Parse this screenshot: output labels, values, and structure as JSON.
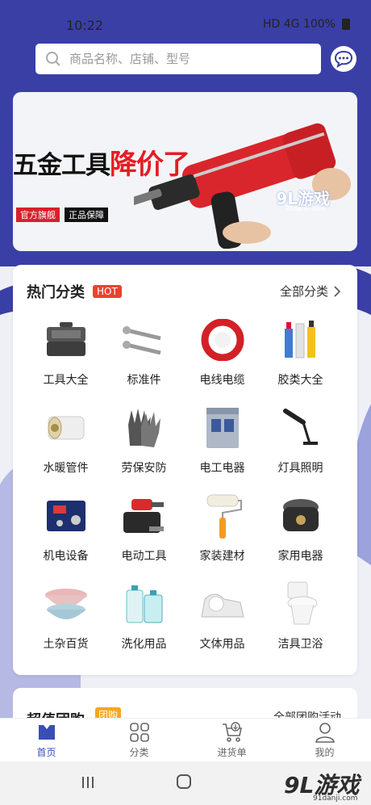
{
  "status_bar": {
    "time": "10:22",
    "indicators": "HD 4G 100%"
  },
  "search": {
    "placeholder": "商品名称、店铺、型号"
  },
  "banner": {
    "headline_prefix": "五金工具",
    "headline_highlight": "降价了",
    "tag1": "官方旗舰",
    "tag2": "正品保障",
    "watermark": "9L游戏",
    "watermark_url": "91danji.com"
  },
  "categories": {
    "title": "热门分类",
    "badge": "HOT",
    "all_label": "全部分类",
    "items": [
      {
        "label": "工具大全",
        "icon": "toolbox-icon"
      },
      {
        "label": "标准件",
        "icon": "screw-icon"
      },
      {
        "label": "电线电缆",
        "icon": "cable-icon"
      },
      {
        "label": "胶类大全",
        "icon": "glue-icon"
      },
      {
        "label": "水暖管件",
        "icon": "pipe-fitting-icon"
      },
      {
        "label": "劳保安防",
        "icon": "glove-icon"
      },
      {
        "label": "电工电器",
        "icon": "breaker-icon"
      },
      {
        "label": "灯具照明",
        "icon": "lamp-icon"
      },
      {
        "label": "机电设备",
        "icon": "welder-icon"
      },
      {
        "label": "电动工具",
        "icon": "screwdriver-icon"
      },
      {
        "label": "家装建材",
        "icon": "roller-icon"
      },
      {
        "label": "家用电器",
        "icon": "rice-cooker-icon"
      },
      {
        "label": "土杂百货",
        "icon": "basin-icon"
      },
      {
        "label": "洗化用品",
        "icon": "detergent-icon"
      },
      {
        "label": "文体用品",
        "icon": "tape-dispenser-icon"
      },
      {
        "label": "洁具卫浴",
        "icon": "toilet-icon"
      }
    ]
  },
  "group_buy": {
    "title": "超值团购",
    "badge": "团购",
    "more": "全部团购活动"
  },
  "bottom_nav": [
    {
      "label": "首页",
      "icon": "home-icon",
      "active": true
    },
    {
      "label": "分类",
      "icon": "grid-icon",
      "active": false
    },
    {
      "label": "进货单",
      "icon": "cart-icon",
      "active": false
    },
    {
      "label": "我的",
      "icon": "user-icon",
      "active": false
    }
  ],
  "system_nav": {
    "logo": "9L游戏",
    "logo_url": "91danji.com"
  },
  "colors": {
    "brand_blue": "#3a3fa6",
    "accent_red": "#e51c23",
    "active_nav": "#3a4fb3"
  }
}
